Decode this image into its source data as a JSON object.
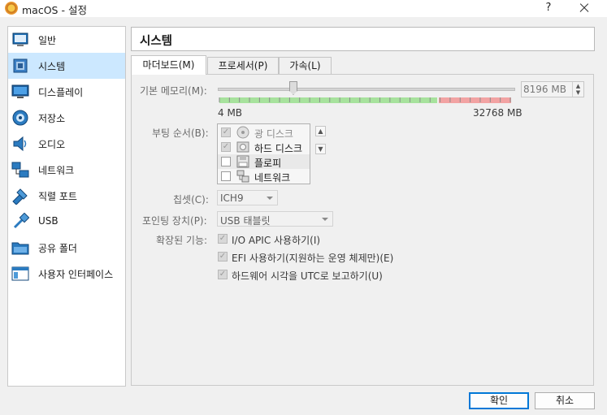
{
  "window": {
    "title": "macOS - 설정",
    "help": "?"
  },
  "sidebar": {
    "items": [
      {
        "label": "일반",
        "icon": "general-icon"
      },
      {
        "label": "시스템",
        "icon": "system-icon"
      },
      {
        "label": "디스플레이",
        "icon": "display-icon"
      },
      {
        "label": "저장소",
        "icon": "storage-icon"
      },
      {
        "label": "오디오",
        "icon": "audio-icon"
      },
      {
        "label": "네트워크",
        "icon": "network-icon"
      },
      {
        "label": "직렬 포트",
        "icon": "serial-port-icon"
      },
      {
        "label": "USB",
        "icon": "usb-icon"
      },
      {
        "label": "공유 폴더",
        "icon": "shared-folder-icon"
      },
      {
        "label": "사용자 인터페이스",
        "icon": "user-interface-icon"
      }
    ],
    "selected": "시스템"
  },
  "content": {
    "title": "시스템",
    "tabs": [
      {
        "label": "마더보드(M)"
      },
      {
        "label": "프로세서(P)"
      },
      {
        "label": "가속(L)"
      }
    ],
    "active_tab": "마더보드(M)",
    "memory": {
      "label": "기본 메모리(M):",
      "value": "8196 MB",
      "min_label": "4 MB",
      "max_label": "32768 MB",
      "min_mb": 4,
      "max_mb": 32768,
      "current_mb": 8196
    },
    "boot_order": {
      "label": "부팅 순서(B):",
      "devices": [
        {
          "label": "광 디스크",
          "checked": true,
          "icon": "optical-disc-icon"
        },
        {
          "label": "하드 디스크",
          "checked": true,
          "icon": "hard-disk-icon"
        },
        {
          "label": "플로피",
          "checked": false,
          "icon": "floppy-icon"
        },
        {
          "label": "네트워크",
          "checked": false,
          "icon": "network-icon"
        }
      ]
    },
    "chipset": {
      "label": "칩셋(C):",
      "value": "ICH9"
    },
    "pointing": {
      "label": "포인팅 장치(P):",
      "value": "USB 태블릿"
    },
    "features": {
      "label": "확장된 기능:",
      "options": [
        {
          "label": "I/O APIC 사용하기(I)",
          "checked": true
        },
        {
          "label": "EFI 사용하기(지원하는 운영 체제만)(E)",
          "checked": true
        },
        {
          "label": "하드웨어 시각을 UTC로 보고하기(U)",
          "checked": true
        }
      ]
    }
  },
  "buttons": {
    "ok": "확인",
    "cancel": "취소"
  },
  "colors": {
    "selection": "#cce8ff",
    "accent": "#0078d7",
    "memory_safe": "#a7e29d",
    "memory_danger": "#f2a3a3"
  }
}
